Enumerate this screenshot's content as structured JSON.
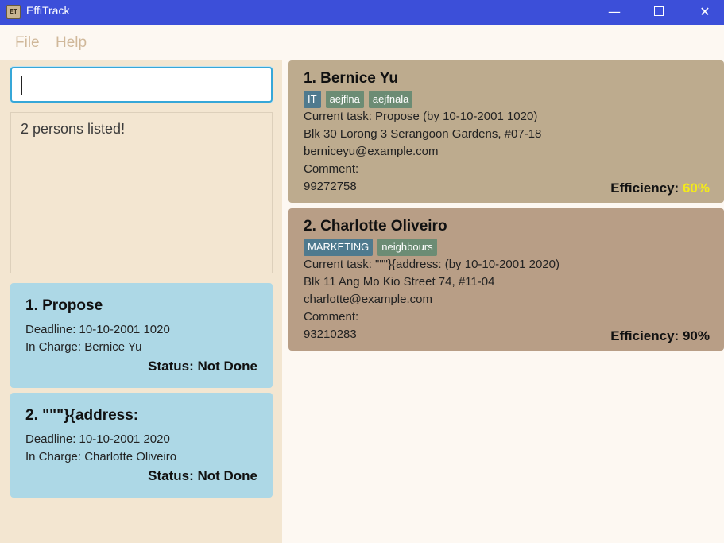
{
  "window": {
    "title": "EffiTrack",
    "icon_text": "ET"
  },
  "menu": {
    "file": "File",
    "help": "Help"
  },
  "command": {
    "value": ""
  },
  "result": {
    "text": "2 persons listed!"
  },
  "tasks": [
    {
      "title": "1.  Propose",
      "deadline": "Deadline: 10-10-2001 1020",
      "in_charge": "In Charge: Bernice Yu",
      "status": "Status: Not Done"
    },
    {
      "title": "2.  \"\"\"}{address:",
      "deadline": "Deadline: 10-10-2001 2020",
      "in_charge": "In Charge: Charlotte Oliveiro",
      "status": "Status: Not Done"
    }
  ],
  "persons": [
    {
      "name": "1.  Bernice Yu",
      "tags": [
        "IT",
        "aejflna",
        "aejfnala"
      ],
      "task": "Current task: Propose (by 10-10-2001 1020)",
      "address": "Blk 30 Lorong 3 Serangoon Gardens, #07-18",
      "email": "berniceyu@example.com",
      "comment": "Comment:",
      "phone": "99272758",
      "efficiency_label": "Efficiency:",
      "efficiency_value": "60%",
      "efficiency_color": "#f3ea1a"
    },
    {
      "name": "2.  Charlotte Oliveiro",
      "tags": [
        "MARKETING",
        "neighbours"
      ],
      "task": "Current task: \"\"\"}{address: (by 10-10-2001 2020)",
      "address": "Blk 11 Ang Mo Kio Street 74, #11-04",
      "email": "charlotte@example.com",
      "comment": "Comment:",
      "phone": "93210283",
      "efficiency_label": "Efficiency:",
      "efficiency_value": "90%",
      "efficiency_color": "#111111"
    }
  ],
  "colors": {
    "titlebar": "#3c4fd9",
    "task_card": "#add8e6",
    "person_card_1": "#bdab8e",
    "person_card_2": "#b89e86",
    "input_focus": "#36a7d8"
  },
  "icons": {
    "minimize": "minimize-icon",
    "maximize": "maximize-icon",
    "close": "close-icon"
  }
}
